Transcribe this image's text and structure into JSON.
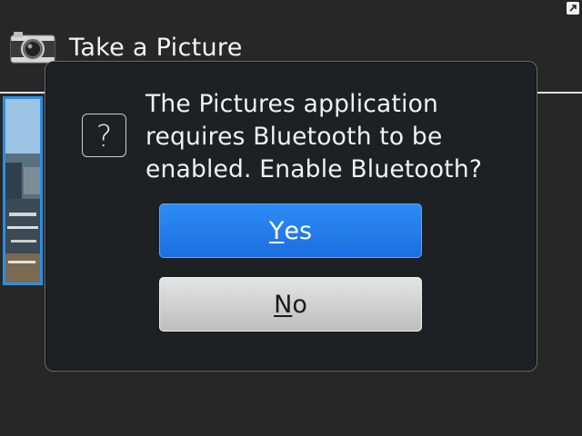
{
  "header": {
    "title": "Take a Picture",
    "icon": "camera-icon"
  },
  "status": {
    "corner_icon": "expand-arrow-icon"
  },
  "dialog": {
    "icon": "question-icon",
    "icon_glyph": "?",
    "message": "The Pictures application requires Bluetooth to be enabled. Enable Bluetooth?",
    "buttons": {
      "yes": {
        "accel": "Y",
        "rest": "es"
      },
      "no": {
        "accel": "N",
        "rest": "o"
      }
    }
  },
  "colors": {
    "background": "#272727",
    "dialog_bg": "#1e2024",
    "primary_button": "#1a6fe0",
    "secondary_button": "#cfcfcf",
    "thumbnail_border": "#2c8fe0"
  }
}
